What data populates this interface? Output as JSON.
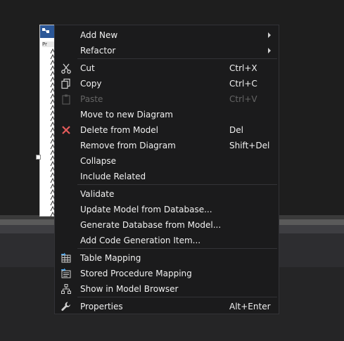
{
  "context_menu": {
    "items": [
      {
        "label": "Add New",
        "shortcut": "",
        "icon": "none",
        "submenu": true,
        "enabled": true
      },
      {
        "label": "Refactor",
        "shortcut": "",
        "icon": "none",
        "submenu": true,
        "enabled": true
      },
      {
        "label": "Cut",
        "shortcut": "Ctrl+X",
        "icon": "scissors-icon",
        "submenu": false,
        "enabled": true
      },
      {
        "label": "Copy",
        "shortcut": "Ctrl+C",
        "icon": "copy-icon",
        "submenu": false,
        "enabled": true
      },
      {
        "label": "Paste",
        "shortcut": "Ctrl+V",
        "icon": "paste-icon",
        "submenu": false,
        "enabled": false
      },
      {
        "label": "Move to new Diagram",
        "shortcut": "",
        "icon": "none",
        "submenu": false,
        "enabled": true
      },
      {
        "label": "Delete from Model",
        "shortcut": "Del",
        "icon": "delete-x-icon",
        "submenu": false,
        "enabled": true
      },
      {
        "label": "Remove from Diagram",
        "shortcut": "Shift+Del",
        "icon": "none",
        "submenu": false,
        "enabled": true
      },
      {
        "label": "Collapse",
        "shortcut": "",
        "icon": "none",
        "submenu": false,
        "enabled": true
      },
      {
        "label": "Include Related",
        "shortcut": "",
        "icon": "none",
        "submenu": false,
        "enabled": true
      },
      {
        "label": "Validate",
        "shortcut": "",
        "icon": "none",
        "submenu": false,
        "enabled": true
      },
      {
        "label": "Update Model from Database...",
        "shortcut": "",
        "icon": "none",
        "submenu": false,
        "enabled": true
      },
      {
        "label": "Generate Database from Model...",
        "shortcut": "",
        "icon": "none",
        "submenu": false,
        "enabled": true
      },
      {
        "label": "Add Code Generation Item...",
        "shortcut": "",
        "icon": "none",
        "submenu": false,
        "enabled": true
      },
      {
        "label": "Table Mapping",
        "shortcut": "",
        "icon": "table-mapping-icon",
        "submenu": false,
        "enabled": true
      },
      {
        "label": "Stored Procedure Mapping",
        "shortcut": "",
        "icon": "stored-procedure-icon",
        "submenu": false,
        "enabled": true
      },
      {
        "label": "Show in Model Browser",
        "shortcut": "",
        "icon": "model-browser-icon",
        "submenu": false,
        "enabled": true
      },
      {
        "label": "Properties",
        "shortcut": "Alt+Enter",
        "icon": "wrench-icon",
        "submenu": false,
        "enabled": true
      }
    ]
  },
  "entity": {
    "section_label": "Pr"
  },
  "colors": {
    "menu_bg": "#1b1b1c",
    "menu_text": "#f1f1f1",
    "disabled_text": "#656565",
    "delete_icon": "#e55b5b",
    "entity_header": "#2b5797"
  }
}
